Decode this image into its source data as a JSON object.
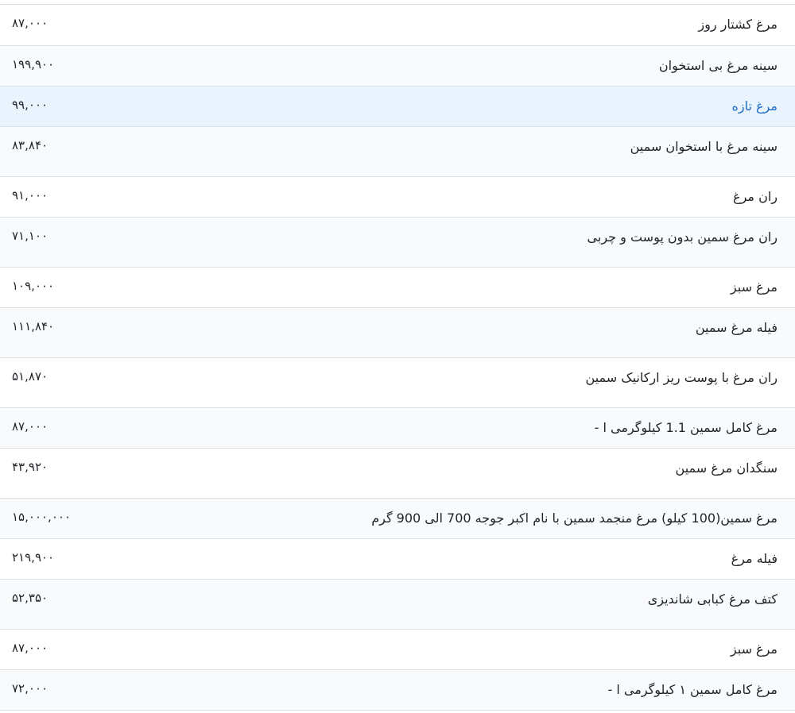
{
  "table": {
    "rows": [
      {
        "name": "مرغ کشتار روز",
        "price": "۸۷,۰۰۰",
        "active": false,
        "tall": false
      },
      {
        "name": "سینه مرغ بی استخوان",
        "price": "۱۹۹,۹۰۰",
        "active": false,
        "tall": false
      },
      {
        "name": "مرغ تازه",
        "price": "۹۹,۰۰۰",
        "active": true,
        "tall": false
      },
      {
        "name": "سینه مرغ با استخوان سمین",
        "price": "۸۳,۸۴۰",
        "active": false,
        "tall": true
      },
      {
        "name": "ران مرغ",
        "price": "۹۱,۰۰۰",
        "active": false,
        "tall": false
      },
      {
        "name": "ران مرغ سمین بدون پوست و چربی",
        "price": "۷۱,۱۰۰",
        "active": false,
        "tall": true
      },
      {
        "name": "مرغ سبز",
        "price": "۱۰۹,۰۰۰",
        "active": false,
        "tall": false
      },
      {
        "name": "فیله مرغ سمین",
        "price": "۱۱۱,۸۴۰",
        "active": false,
        "tall": true
      },
      {
        "name": "ران مرغ با پوست ریز ارکانیک سمین",
        "price": "۵۱,۸۷۰",
        "active": false,
        "tall": true
      },
      {
        "name": "مرغ کامل سمین 1.1 کیلوگرمی ا -",
        "price": "۸۷,۰۰۰",
        "active": false,
        "tall": false
      },
      {
        "name": "سنگدان مرغ سمین",
        "price": "۴۳,۹۲۰",
        "active": false,
        "tall": true
      },
      {
        "name": "مرغ سمین(100 کیلو) مرغ منجمد سمین با نام اکبر جوجه 700 الی 900 گرم",
        "price": "۱۵,۰۰۰,۰۰۰",
        "active": false,
        "tall": false
      },
      {
        "name": "فیله مرغ",
        "price": "۲۱۹,۹۰۰",
        "active": false,
        "tall": false
      },
      {
        "name": "کتف مرغ کبابی شاندیزی",
        "price": "۵۲,۳۵۰",
        "active": false,
        "tall": true
      },
      {
        "name": "مرغ سبز",
        "price": "۸۷,۰۰۰",
        "active": false,
        "tall": false
      },
      {
        "name": "مرغ کامل سمین ۱ کیلوگرمی ا -",
        "price": "۷۲,۰۰۰",
        "active": false,
        "tall": false
      }
    ]
  }
}
